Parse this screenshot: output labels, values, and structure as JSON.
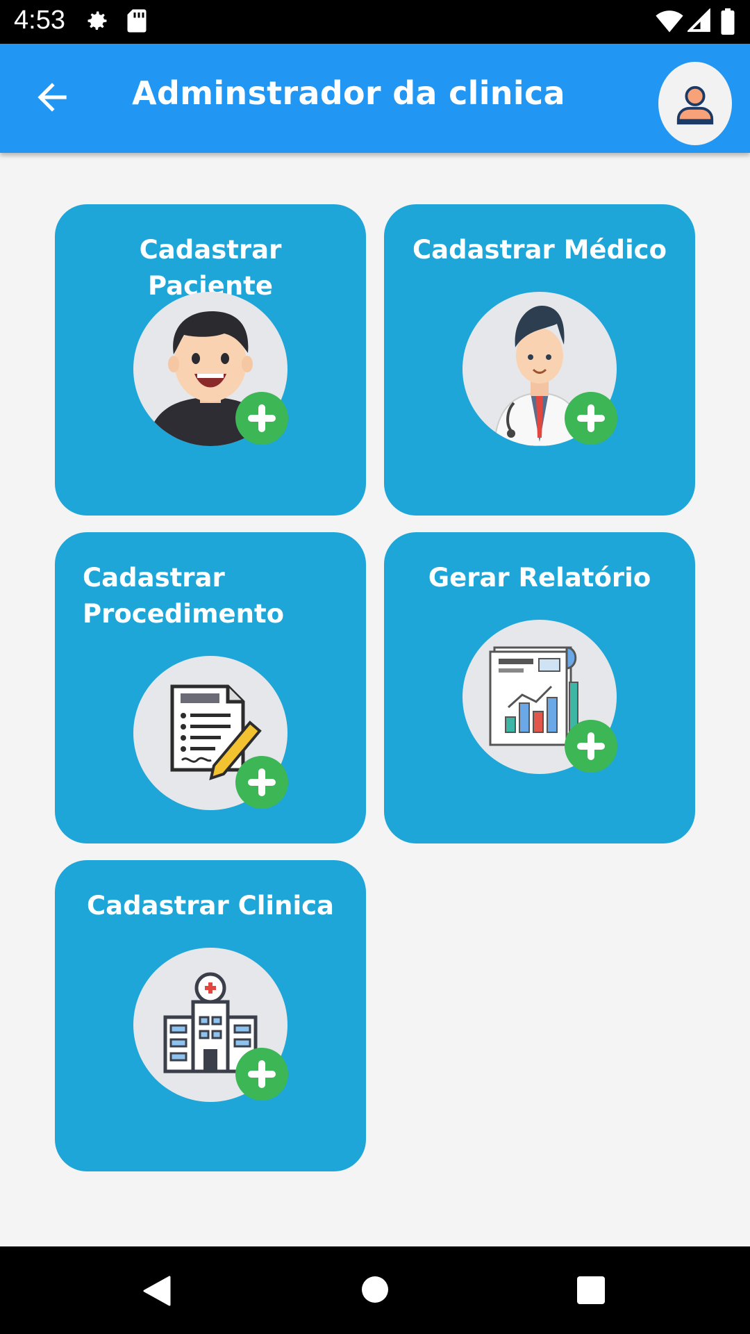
{
  "status_bar": {
    "time": "4:53",
    "icons": [
      "settings-icon",
      "sd-card-icon",
      "wifi-icon",
      "signal-icon",
      "battery-icon"
    ]
  },
  "app_bar": {
    "title": "Adminstrador da clinica",
    "back_icon": "arrow-back-icon",
    "profile_icon": "person-icon",
    "color": "#2196f3"
  },
  "cards": [
    {
      "title": "Cadastrar Paciente",
      "icon": "patient-icon"
    },
    {
      "title": "Cadastrar Médico",
      "icon": "doctor-icon"
    },
    {
      "title": "Cadastrar Procedimento",
      "icon": "procedure-document-icon"
    },
    {
      "title": "Gerar Relatório",
      "icon": "report-chart-icon"
    },
    {
      "title": "Cadastrar Clinica",
      "icon": "hospital-icon"
    }
  ],
  "card_color": "#1fa6d8",
  "badge_color": "#3db655",
  "nav_bar": {
    "icons": [
      "back-triangle-icon",
      "home-circle-icon",
      "recents-square-icon"
    ]
  }
}
